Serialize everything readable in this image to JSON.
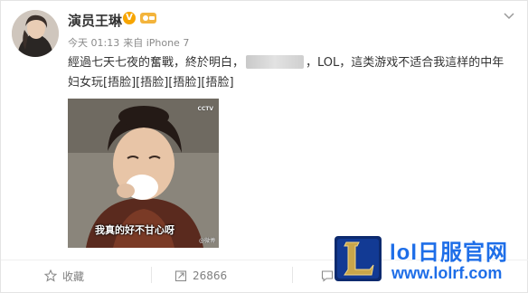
{
  "post": {
    "username": "演员王琳",
    "verified_badge": "V",
    "time": "今天 01:13",
    "source": "来自 iPhone 7",
    "text_before": "經過七天七夜的奮戰，終於明白，",
    "text_after": "，LOL，這类游戏不适合我這样的中年",
    "text_line2": "妇女玩[捂脸][捂脸][捂脸][捂脸]",
    "photo": {
      "caption": "我真的好不甘心呀",
      "watermark_top": "CCTV",
      "watermark_bottom": "@微博"
    }
  },
  "actions": {
    "favorite_label": "收藏",
    "repost_count": "26866"
  },
  "watermark": {
    "name": "lol日服官网",
    "url": "www.lolrf.com",
    "logo_letter": "L",
    "color": "#1e6ee8"
  },
  "icons": {
    "verified": "verified-badge-icon",
    "chevron": "chevron-down-icon",
    "favorite": "star-icon",
    "repost": "repost-icon",
    "comment": "comment-icon"
  }
}
